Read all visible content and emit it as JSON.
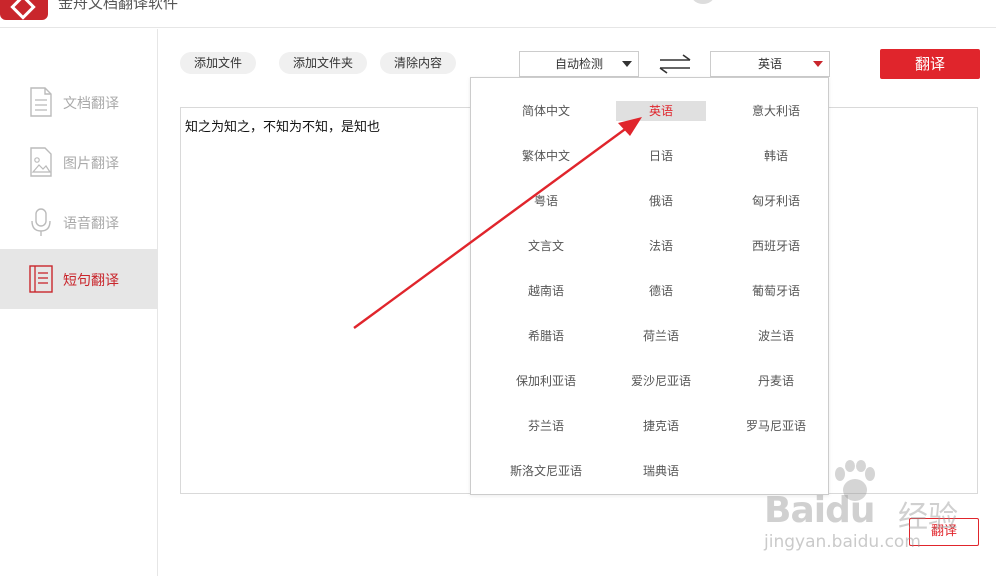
{
  "app": {
    "title": "金舟文档翻译软件"
  },
  "sidebar": {
    "items": [
      {
        "label": "文档翻译",
        "icon": "document-icon",
        "active": false
      },
      {
        "label": "图片翻译",
        "icon": "image-icon",
        "active": false
      },
      {
        "label": "语音翻译",
        "icon": "microphone-icon",
        "active": false
      },
      {
        "label": "短句翻译",
        "icon": "sentence-icon",
        "active": true
      }
    ]
  },
  "toolbar": {
    "add_file": "添加文件",
    "add_folder": "添加文件夹",
    "clear_content": "清除内容",
    "source_lang": "自动检测",
    "target_lang": "英语",
    "translate": "翻译"
  },
  "editor": {
    "text": "知之为知之，不知为不知，是知也"
  },
  "footer": {
    "translate": "翻译"
  },
  "dropdown": {
    "selected": "英语",
    "languages": [
      "简体中文",
      "英语",
      "意大利语",
      "繁体中文",
      "日语",
      "韩语",
      "粤语",
      "俄语",
      "匈牙利语",
      "文言文",
      "法语",
      "西班牙语",
      "越南语",
      "德语",
      "葡萄牙语",
      "希腊语",
      "荷兰语",
      "波兰语",
      "保加利亚语",
      "爱沙尼亚语",
      "丹麦语",
      "芬兰语",
      "捷克语",
      "罗马尼亚语",
      "斯洛文尼亚语",
      "瑞典语"
    ]
  },
  "watermark": {
    "brand": "Baidu",
    "brand_cn": "经验",
    "url": "jingyan.baidu.com"
  },
  "colors": {
    "accent": "#e0252c",
    "brand": "#c9262c",
    "sidebar_active_bg": "#e6e6e6"
  }
}
